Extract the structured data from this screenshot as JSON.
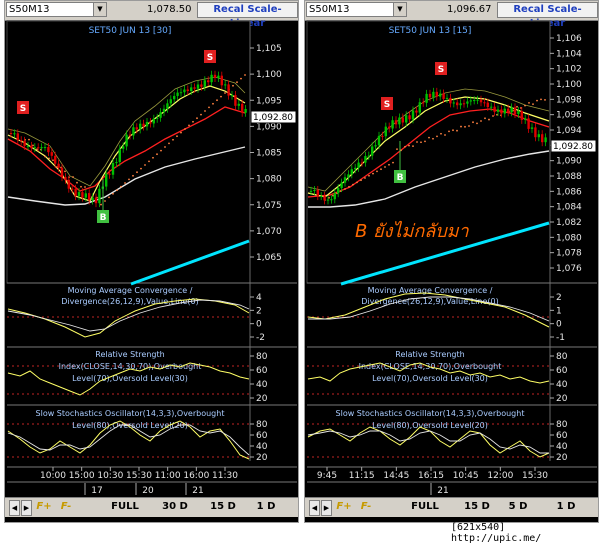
{
  "left": {
    "symbol": "S50M13",
    "price": "1,078.50",
    "recal_label": "Recal Scale-Linear",
    "chart_title": "SET50 JUN 13   [30]",
    "y_ticks": [
      "1,105",
      "1,100",
      "1,095",
      "1,090",
      "1,085",
      "1,080",
      "1,075",
      "1,070",
      "1,065"
    ],
    "last_price_tag": "1,092.80",
    "signals": {
      "sell": "S",
      "buy": "B"
    },
    "macd_title_1": "Moving Average Convergence /",
    "macd_title_2": "Divergence(26,12,9),Value,Line(0)",
    "macd_ticks": [
      "4",
      "2",
      "0",
      "-2"
    ],
    "rsi_title_1": "Relative Strength",
    "rsi_title_2": "Index(CLOSE,14,30,70),Overbought",
    "rsi_title_3": "Level(70),Oversold Level(30)",
    "rsi_ticks": [
      "80",
      "60",
      "40",
      "20"
    ],
    "stoch_title_1": "Slow Stochastics Oscillator(14,3,3),Overbought",
    "stoch_title_2": "Level(80),Oversold Level(20)",
    "stoch_ticks": [
      "80",
      "60",
      "40",
      "20"
    ],
    "time_ticks": [
      "10:00",
      "15:00",
      "10:30",
      "15:30",
      "11:00",
      "16:00",
      "11:30"
    ],
    "date_ticks": [
      "17",
      "20",
      "21"
    ]
  },
  "right": {
    "symbol": "S50M13",
    "price": "1,096.67",
    "recal_label": "Recal Scale-Linear",
    "chart_title": "SET50 JUN 13   [15]",
    "y_ticks": [
      "1,106",
      "1,104",
      "1,102",
      "1,100",
      "1,098",
      "1,096",
      "1,094",
      "1,092",
      "1,090",
      "1,088",
      "1,086",
      "1,084",
      "1,082",
      "1,080",
      "1,078",
      "1,076"
    ],
    "last_price_tag": "1,092.80",
    "signals": {
      "sell": "S",
      "buy": "B"
    },
    "annotation": "B ยังไม่กลับมา",
    "macd_title_1": "Moving Average Convergence /",
    "macd_title_2": "Divergence(26,12,9),Value,Line(0)",
    "macd_ticks": [
      "2",
      "1",
      "0",
      "-1"
    ],
    "rsi_title_1": "Relative Strength",
    "rsi_title_2": "Index(CLOSE,14,30,70),Overbought",
    "rsi_title_3": "Level(70),Oversold Level(30)",
    "rsi_ticks": [
      "80",
      "60",
      "40",
      "20"
    ],
    "stoch_title_1": "Slow Stochastics Oscillator(14,3,3),Overbought",
    "stoch_title_2": "Level(80),Oversold Level(20)",
    "stoch_ticks": [
      "80",
      "60",
      "40",
      "20"
    ],
    "time_ticks": [
      "9:45",
      "11:15",
      "14:45",
      "16:15",
      "10:45",
      "12:00",
      "15:30"
    ],
    "date_ticks": [
      "21"
    ]
  },
  "bottom_bar": {
    "full": "FULL",
    "d30": "30 D",
    "d15": "15 D",
    "d5": "5 D",
    "d1": "1 D",
    "f_plus": "F+",
    "f_minus": "F-"
  },
  "caption": "[621x540] http://upic.me/",
  "colors": {
    "background": "#000000",
    "candle_up": "#00c000",
    "candle_down": "#e00000",
    "ma_fast": "#ffff66",
    "ma_mid": "#ff2020",
    "ma_slow": "#e6e6e6",
    "long_trend": "#00e5ff",
    "sar": "#ff8040",
    "signal_box": "#e02020",
    "buy_box": "#40c040",
    "annotation": "#ff6a00",
    "title": "#66aaff"
  }
}
